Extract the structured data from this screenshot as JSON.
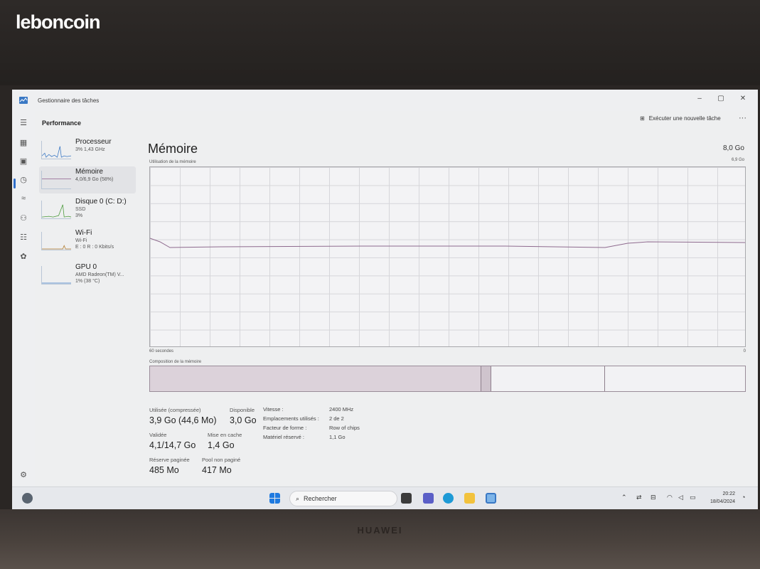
{
  "watermark": "leboncoin",
  "laptop_brand": "HUAWEI",
  "window": {
    "title": "Gestionnaire des tâches",
    "minimize": "–",
    "maximize": "▢",
    "close": "✕"
  },
  "header": {
    "section": "Performance",
    "new_task": "Exécuter une nouvelle tâche",
    "more": "···"
  },
  "sidebar": {
    "items": [
      {
        "name": "Processeur",
        "sub1": "3%  1,43 GHz",
        "sub2": "",
        "sub3": ""
      },
      {
        "name": "Mémoire",
        "sub1": "4,0/6,9 Go (58%)",
        "sub2": "",
        "sub3": ""
      },
      {
        "name": "Disque 0 (C: D:)",
        "sub1": "SSD",
        "sub2": "3%",
        "sub3": ""
      },
      {
        "name": "Wi-Fi",
        "sub1": "Wi-Fi",
        "sub2": "E : 0 R : 0 Kbits/s",
        "sub3": ""
      },
      {
        "name": "GPU 0",
        "sub1": "AMD Radeon(TM) V...",
        "sub2": "1% (38 °C)",
        "sub3": ""
      }
    ]
  },
  "memory": {
    "title": "Mémoire",
    "total": "8,0 Go",
    "usage_label": "Utilisation de la mémoire",
    "usage_max": "6,9 Go",
    "time_label": "60 secondes",
    "min_label": "0",
    "composition_label": "Composition de la mémoire",
    "stats": {
      "used_label": "Utilisée (compressée)",
      "used_value": "3,9 Go (44,6 Mo)",
      "available_label": "Disponible",
      "available_value": "3,0 Go",
      "committed_label": "Validée",
      "committed_value": "4,1/14,7 Go",
      "cached_label": "Mise en cache",
      "cached_value": "1,4 Go",
      "paged_label": "Réserve paginée",
      "paged_value": "485 Mo",
      "nonpaged_label": "Pool non paginé",
      "nonpaged_value": "417 Mo"
    },
    "details": [
      {
        "label": "Vitesse :",
        "value": "2400 MHz"
      },
      {
        "label": "Emplacements utilisés :",
        "value": "2 de 2"
      },
      {
        "label": "Facteur de forme :",
        "value": "Row of chips"
      },
      {
        "label": "Matériel réservé :",
        "value": "1,1 Go"
      }
    ]
  },
  "taskbar": {
    "search_placeholder": "Rechercher",
    "clock_time": "20:22",
    "clock_date": "18/04/2024"
  }
}
